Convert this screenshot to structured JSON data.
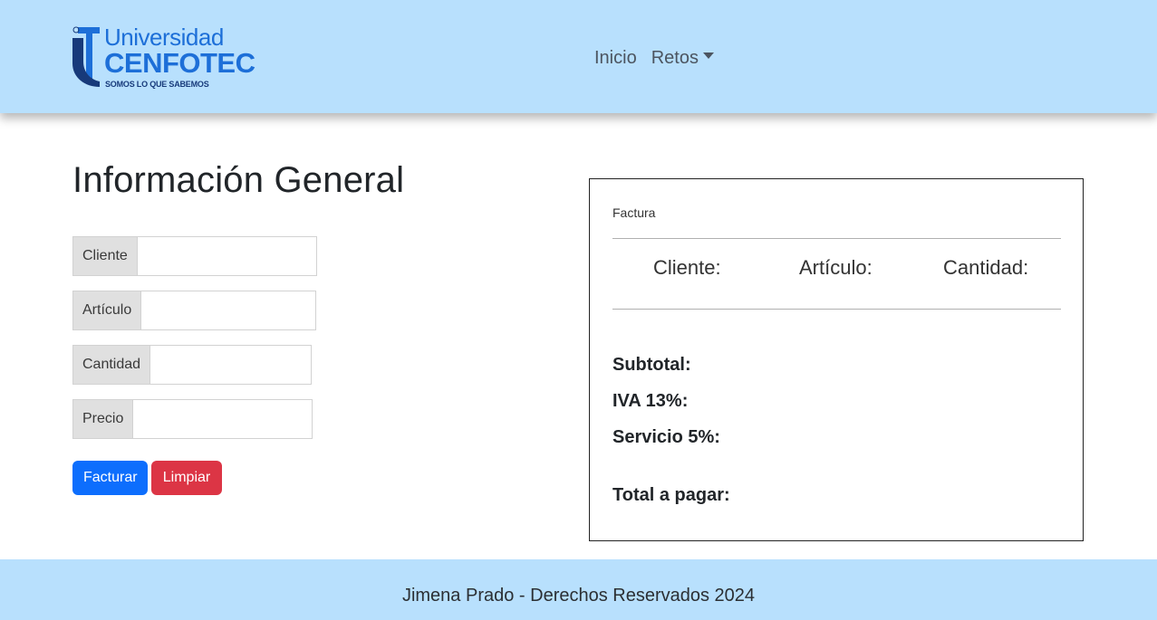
{
  "brand": {
    "top": "Universidad",
    "main": "CENFOTEC",
    "tagline": "SOMOS LO QUE SABEMOS"
  },
  "nav": {
    "inicio": "Inicio",
    "retos": "Retos"
  },
  "page_title": "Información General",
  "form": {
    "cliente_label": "Cliente",
    "cliente_value": "",
    "articulo_label": "Artículo",
    "articulo_value": "",
    "cantidad_label": "Cantidad",
    "cantidad_value": "",
    "precio_label": "Precio",
    "precio_value": ""
  },
  "buttons": {
    "facturar": "Facturar",
    "limpiar": "Limpiar"
  },
  "invoice": {
    "caption": "Factura",
    "col_cliente": "Cliente:",
    "col_articulo": "Artículo:",
    "col_cantidad": "Cantidad:",
    "subtotal": "Subtotal:",
    "iva": "IVA 13%:",
    "servicio": "Servicio 5%:",
    "total": "Total a pagar:"
  },
  "footer": {
    "text": "Jimena Prado - Derechos Reservados 2024"
  },
  "colors": {
    "header_bg": "#b8e0fd",
    "primary": "#0d6efd",
    "danger": "#dc3545",
    "brand_blue": "#1d6fd8"
  }
}
